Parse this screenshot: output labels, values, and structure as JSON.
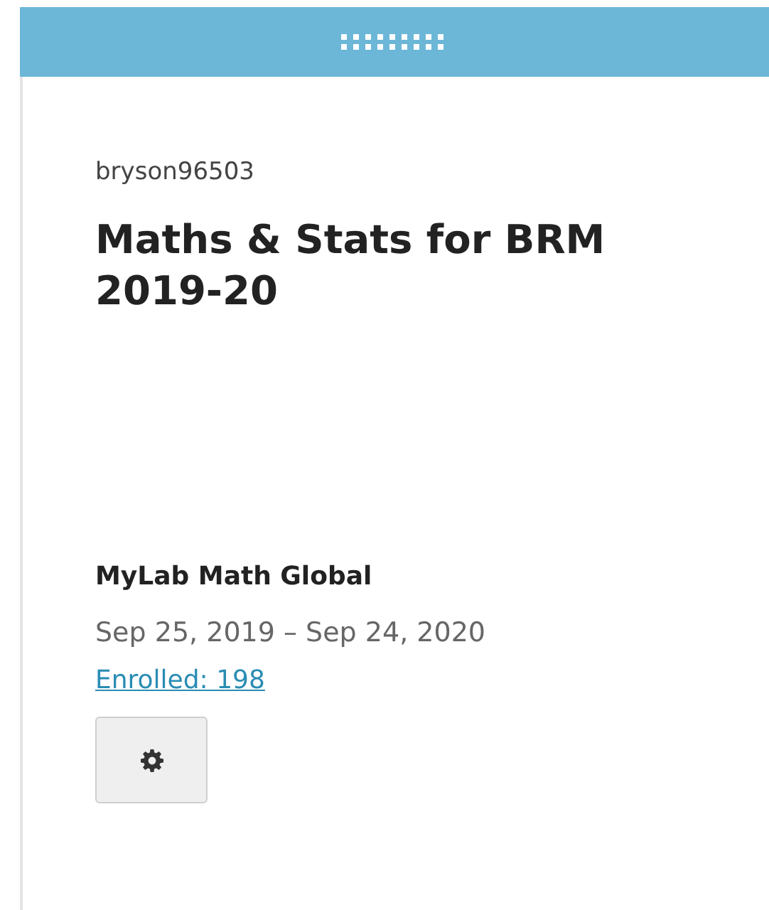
{
  "card": {
    "owner": "bryson96503",
    "title": "Maths & Stats for BRM 2019-20",
    "product": "MyLab Math Global",
    "dates": "Sep 25, 2019 – Sep 24, 2020",
    "enrolled_link": "Enrolled: 198"
  }
}
